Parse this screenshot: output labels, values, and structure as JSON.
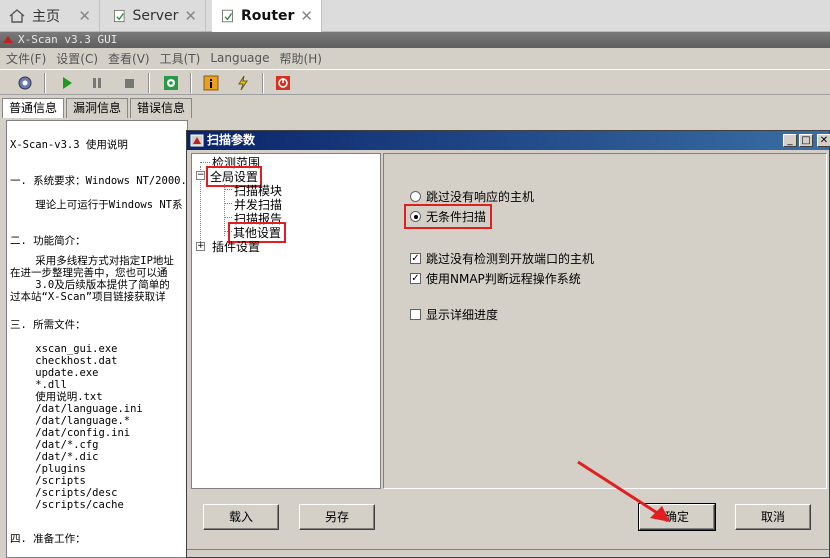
{
  "browser_tabs": [
    {
      "label": "主页",
      "icon": "home-icon"
    },
    {
      "label": "Server",
      "icon": "page-icon"
    },
    {
      "label": "Router",
      "icon": "page-icon",
      "active": true
    }
  ],
  "app": {
    "title": "X-Scan v3.3 GUI",
    "menu": [
      "文件(F)",
      "设置(C)",
      "查看(V)",
      "工具(T)",
      "Language",
      "帮助(H)"
    ]
  },
  "info_tabs": [
    "普通信息",
    "漏洞信息",
    "错误信息"
  ],
  "info_lines": [
    "X-Scan-v3.3 使用说明",
    "一. 系统要求：Windows NT/2000.",
    "    理论上可运行于Windows NT系",
    "二. 功能简介：",
    "    采用多线程方式对指定IP地址",
    "在进一步整理完善中，您也可以通",
    "    3.0及后续版本提供了简单的",
    "过本站“X-Scan”项目链接获取详",
    "三. 所需文件：",
    "    xscan_gui.exe",
    "    checkhost.dat",
    "    update.exe",
    "    *.dll",
    "    使用说明.txt",
    "    /dat/language.ini",
    "    /dat/language.*",
    "    /dat/config.ini",
    "    /dat/*.cfg",
    "    /dat/*.dic",
    "    /plugins",
    "    /scripts",
    "    /scripts/desc",
    "    /scripts/cache",
    "四. 准备工作："
  ],
  "dialog": {
    "title": "扫描参数",
    "tree": {
      "detect_range": "检测范围",
      "global": "全局设置",
      "scan_module": "扫描模块",
      "concurrent": "并发扫描",
      "report": "扫描报告",
      "other": "其他设置",
      "plugin": "插件设置"
    },
    "options": {
      "skip_no_response": "跳过没有响应的主机",
      "unconditional": "无条件扫描",
      "skip_no_open_port": "跳过没有检测到开放端口的主机",
      "use_nmap": "使用NMAP判断远程操作系统",
      "show_progress": "显示详细进度"
    },
    "selected_radio": "unconditional",
    "buttons": {
      "load": "载入",
      "save_as": "另存",
      "ok": "确定",
      "cancel": "取消"
    }
  },
  "colors": {
    "highlight": "#e02020",
    "titlebar": "#0a246a"
  }
}
